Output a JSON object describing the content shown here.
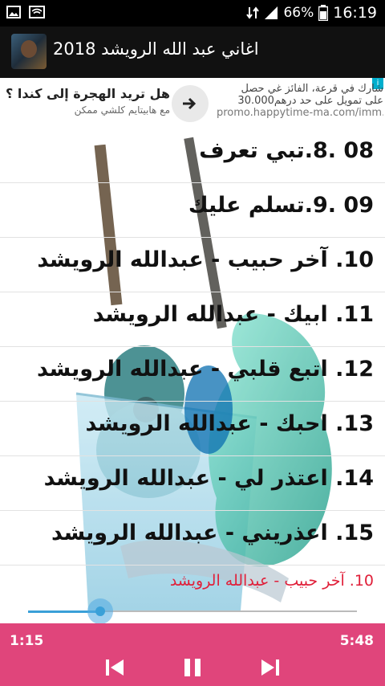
{
  "status_bar": {
    "battery": "66%",
    "time": "16:19"
  },
  "app_bar": {
    "title": "اغاني عبد الله الرويشد 2018"
  },
  "ad": {
    "headline": "هل تريد الهجرة إلى كندا ؟",
    "sub": "مع هابيتايم كلشي ممكن",
    "right_line1": "شارك في قرعة، الفائز غي حصل",
    "right_line2": "على تمويل على حد درهم30.000",
    "url": "promo.happytime-ma.com/imm..."
  },
  "tracks": [
    "08 .8.تبي تعرف",
    "09 .9.تسلم عليك",
    "10. آخر حبيب - عبدالله الرويشد",
    "11. ابيك - عبدالله الرويشد",
    "12. اتبع قلبي - عبدالله الرويشد",
    "13. احبك - عبدالله الرويشد",
    "14. اعتذر لي - عبدالله الرويشد",
    "15. اعذريني - عبدالله الرويشد"
  ],
  "now_playing": "10. آخر حبيب - عبدالله الرويشد",
  "player": {
    "current_time": "1:15",
    "duration": "5:48",
    "progress": 0.22
  },
  "colors": {
    "player_bar": "#e0457b",
    "now_playing_text": "#e0203a",
    "seek_accent": "#3aa0d8"
  },
  "icons": {
    "previous": "skip-previous-icon",
    "pause": "pause-icon",
    "next": "skip-next-icon"
  }
}
